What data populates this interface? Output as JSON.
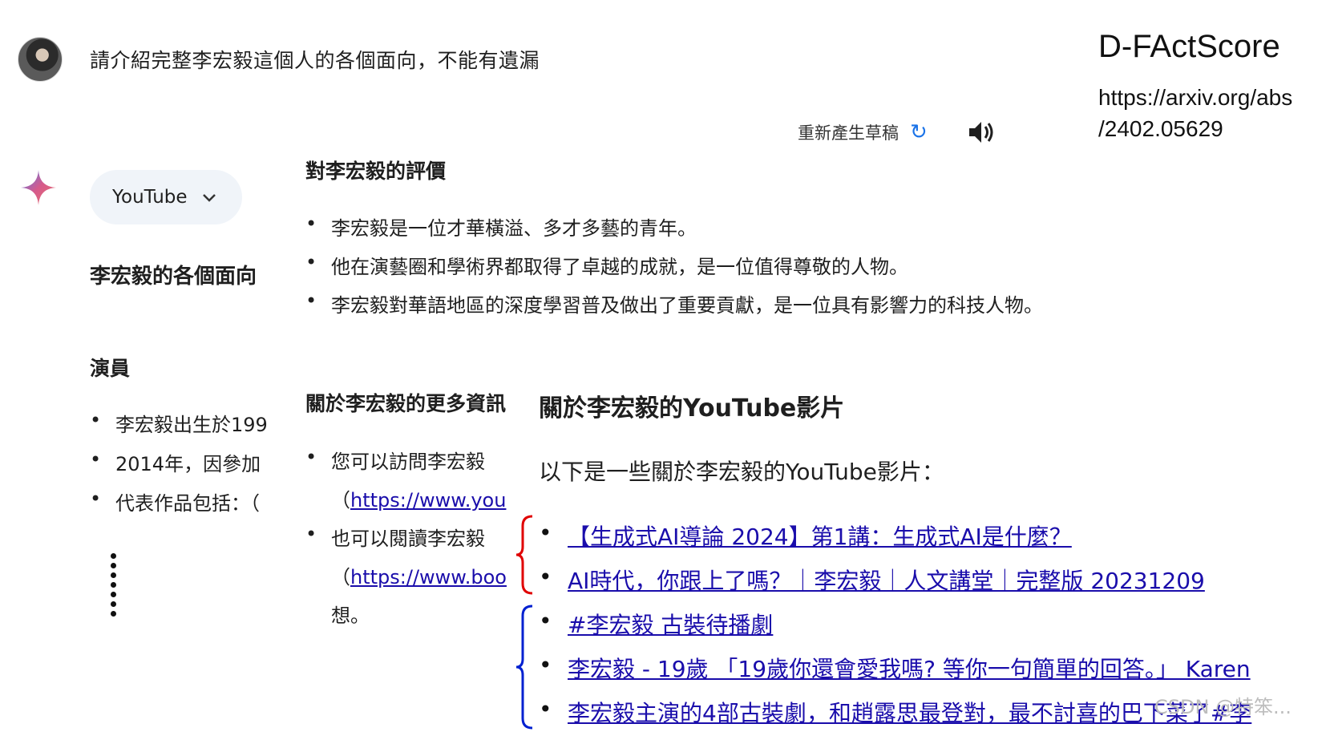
{
  "prompt": "請介紹完整李宏毅這個人的各個面向，不能有遺漏",
  "reference": {
    "title": "D-FActScore",
    "url_line1": "https://arxiv.org/abs",
    "url_line2": "/2402.05629"
  },
  "toolbar": {
    "regenerate_label": "重新產生草稿"
  },
  "source_chip": {
    "label": "YouTube"
  },
  "left_panel": {
    "heading": "李宏毅的各個面向",
    "subheading": "演員",
    "items": [
      "李宏毅出生於199",
      "2014年，因參加",
      "代表作品包括：（"
    ]
  },
  "middle_panel": {
    "heading": "對李宏毅的評價",
    "items": [
      "李宏毅是一位才華橫溢、多才多藝的青年。",
      "他在演藝圈和學術界都取得了卓越的成就，是一位值得尊敬的人物。",
      "李宏毅對華語地區的深度學習普及做出了重要貢獻，是一位具有影響力的科技人物。"
    ],
    "more_heading": "關於李宏毅的更多資訊",
    "more_items": [
      {
        "text": "您可以訪問李宏毅",
        "link": "https://www.you"
      },
      {
        "text": "也可以閱讀李宏毅",
        "link": "https://www.boo",
        "tail": "想。"
      }
    ]
  },
  "right_panel": {
    "heading": "關於李宏毅的YouTube影片",
    "intro": "以下是一些關於李宏毅的YouTube影片：",
    "videos": [
      "【生成式AI導論 2024】第1講：生成式AI是什麼？",
      "AI時代，你跟上了嗎？｜李宏毅｜人文講堂｜完整版 20231209",
      "#李宏毅 古裝待播劇",
      "李宏毅 - 19歲 「19歲你還會愛我嗎? 等你一句簡單的回答。」 Karen",
      "李宏毅主演的4部古裝劇，和趙露思最登對，最不討喜的巴下菜了#李"
    ]
  },
  "watermark": "CSDN @特笨...",
  "colors": {
    "link": "#1a0dab",
    "refresh_icon": "#1a73e8",
    "red_brace": "#e00000",
    "blue_brace": "#0020d0",
    "chip_bg": "#f0f4f9"
  },
  "icons": [
    "avatar",
    "gemini-star-icon",
    "chevron-down-icon",
    "refresh-icon",
    "speaker-icon"
  ]
}
